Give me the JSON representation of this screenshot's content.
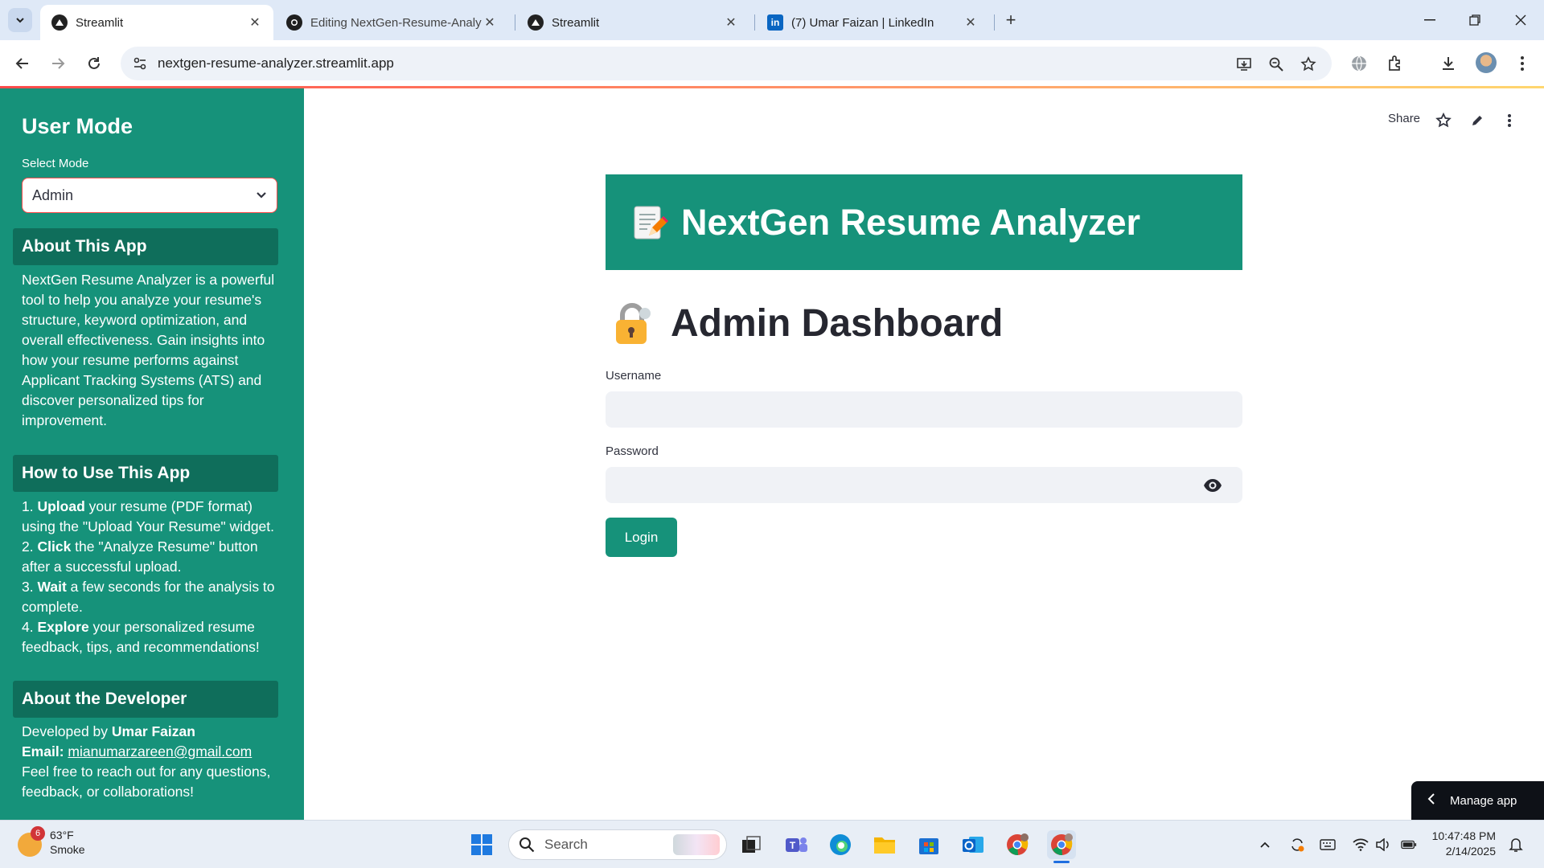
{
  "browser": {
    "tabs": [
      {
        "title": "Streamlit",
        "icon": "streamlit-icon",
        "active": true
      },
      {
        "title": "Editing NextGen-Resume-Analy",
        "icon": "github-icon",
        "active": false
      },
      {
        "title": "Streamlit",
        "icon": "streamlit-icon",
        "active": false
      },
      {
        "title": "(7) Umar Faizan | LinkedIn",
        "icon": "linkedin-icon",
        "active": false
      }
    ],
    "url": "nextgen-resume-analyzer.streamlit.app"
  },
  "sidebar": {
    "title": "User Mode",
    "select_label": "Select Mode",
    "select_value": "Admin",
    "about_app": {
      "heading": "About This App",
      "body": "NextGen Resume Analyzer is a powerful tool to help you analyze your resume's structure, keyword optimization, and overall effectiveness. Gain insights into how your resume performs against Applicant Tracking Systems (ATS) and discover personalized tips for improvement."
    },
    "how_to": {
      "heading": "How to Use This App",
      "steps": [
        {
          "num": "1.",
          "bold": "Upload",
          "text": " your resume (PDF format) using the \"Upload Your Resume\" widget."
        },
        {
          "num": "2.",
          "bold": "Click",
          "text": " the \"Analyze Resume\" button after a successful upload."
        },
        {
          "num": "3.",
          "bold": "Wait",
          "text": " a few seconds for the analysis to complete."
        },
        {
          "num": "4.",
          "bold": "Explore",
          "text": " your personalized resume feedback, tips, and recommendations!"
        }
      ]
    },
    "developer": {
      "heading": "About the Developer",
      "developed_by_label": "Developed by ",
      "name": "Umar Faizan",
      "email_label": "Email:",
      "email": "mianumarzareen@gmail.com",
      "note": "Feel free to reach out for any questions, feedback, or collaborations!"
    }
  },
  "header": {
    "share_label": "Share"
  },
  "main": {
    "banner_title": "NextGen Resume Analyzer",
    "dashboard_title": "Admin Dashboard",
    "username_label": "Username",
    "username_value": "",
    "password_label": "Password",
    "password_value": "",
    "login_label": "Login",
    "manage_app_label": "Manage app"
  },
  "taskbar": {
    "weather_badge": "6",
    "temperature": "63°F",
    "condition": "Smoke",
    "search_label": "Search",
    "time": "10:47:48 PM",
    "date": "2/14/2025"
  },
  "colors": {
    "brand_green": "#16927a",
    "section_green": "#0f6e5b",
    "accent_red": "#ff4b4b"
  }
}
